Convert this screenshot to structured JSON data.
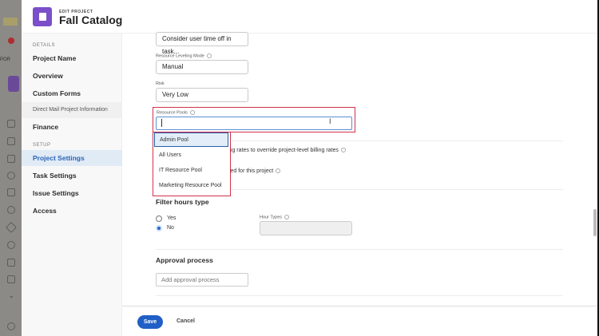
{
  "background_app": {
    "partial_label": "POR"
  },
  "header": {
    "eyebrow": "EDIT PROJECT",
    "title": "Fall Catalog"
  },
  "sidebar": {
    "sections": [
      {
        "label": "DETAILS"
      },
      {
        "label": "SETUP"
      }
    ],
    "items": [
      {
        "label": "Project Name"
      },
      {
        "label": "Overview"
      },
      {
        "label": "Custom Forms"
      },
      {
        "label": "Direct Mail Project Information"
      },
      {
        "label": "Finance"
      },
      {
        "label": "Project Settings",
        "active": true
      },
      {
        "label": "Task Settings"
      },
      {
        "label": "Issue Settings"
      },
      {
        "label": "Access"
      }
    ]
  },
  "form": {
    "time_off_value": "Consider user time off in task...",
    "leveling_label": "Resource Leveling Mode",
    "leveling_value": "Manual",
    "risk_label": "Risk",
    "risk_value": "Very Low",
    "pools_label": "Resource Pools",
    "pools_value": "",
    "pools_options": [
      "Admin Pool",
      "All Users",
      "IT Resource Pool",
      "Marketing Resource Pool"
    ],
    "billing_text": "ing rates to override project-level billing rates",
    "approved_text": "ved for this project",
    "filter_title": "Filter hours type",
    "radio_yes": "Yes",
    "radio_no": "No",
    "radio_selected": "No",
    "hour_types_label": "Hour Types",
    "approval_title": "Approval process",
    "approval_placeholder": "Add approval process"
  },
  "footer": {
    "save": "Save",
    "cancel": "Cancel"
  },
  "colors": {
    "accent": "#1f5fc6",
    "highlight": "#d2324c",
    "brand": "#7b4fc9"
  }
}
